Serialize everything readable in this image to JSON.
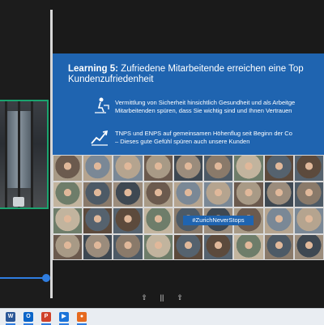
{
  "slide": {
    "title_label": "Learning 5:",
    "title_text": " Zufriedene Mitarbeitende erreichen eine Top Kundenzufriedenheit",
    "bullets": [
      {
        "icon": "person-at-desk-icon",
        "line1": "Vermittlung von Sicherheit hinsichtlich Gesundheit und als Arbeitge",
        "line2": "Mitarbeitenden spüren, dass Sie wichtig sind und Ihnen Vertrauen"
      },
      {
        "icon": "rising-chart-icon",
        "line1": "TNPS und ENPS auf gemeinsamen Höhenflug seit Beginn der Co",
        "line2": "– Dieses gute Gefühl spüren auch unsere Kunden"
      }
    ],
    "hashtag": "#ZurichNeverStops"
  },
  "slide_controls": {
    "prev": "⇧",
    "pause": "||",
    "next": "⇧"
  },
  "colors": {
    "slide_blue": "#1f64b0",
    "active_border": "#1aa36e",
    "progress": "#2f7de0"
  },
  "taskbar": {
    "apps": [
      {
        "name": "word-icon",
        "letter": "W",
        "color": "#2b5797"
      },
      {
        "name": "outlook-icon",
        "letter": "O",
        "color": "#0a64c8"
      },
      {
        "name": "powerpoint-icon",
        "letter": "P",
        "color": "#d0422a"
      },
      {
        "name": "video-player-icon",
        "letter": "▶",
        "color": "#1a73d9"
      },
      {
        "name": "firefox-icon",
        "letter": "●",
        "color": "#e66a1f"
      }
    ]
  }
}
